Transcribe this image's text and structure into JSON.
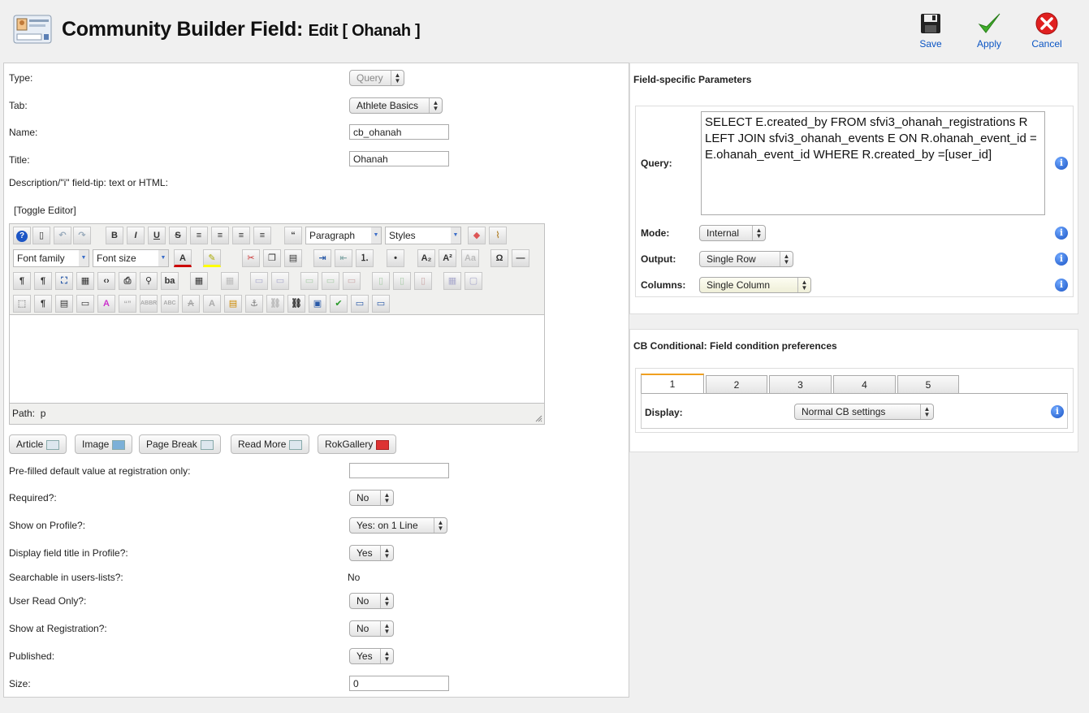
{
  "header": {
    "title": "Community Builder Field:",
    "subtitle": "Edit [ Ohanah ]",
    "save_label": "Save",
    "apply_label": "Apply",
    "cancel_label": "Cancel"
  },
  "form": {
    "type_label": "Type:",
    "type_value": "Query",
    "tab_label": "Tab:",
    "tab_value": "Athlete Basics",
    "name_label": "Name:",
    "name_value": "cb_ohanah",
    "title_label": "Title:",
    "title_value": "Ohanah",
    "description_label": "Description/\"i\" field-tip: text or HTML:",
    "toggle_editor": "[Toggle Editor]",
    "prefilled_label": "Pre-filled default value at registration only:",
    "prefilled_value": "",
    "required_label": "Required?:",
    "required_value": "No",
    "show_profile_label": "Show on Profile?:",
    "show_profile_value": "Yes: on 1 Line",
    "display_title_label": "Display field title in Profile?:",
    "display_title_value": "Yes",
    "searchable_label": "Searchable in users-lists?:",
    "searchable_value": "No",
    "read_only_label": "User Read Only?:",
    "read_only_value": "No",
    "show_reg_label": "Show at Registration?:",
    "show_reg_value": "No",
    "published_label": "Published:",
    "published_value": "Yes",
    "size_label": "Size:",
    "size_value": "0"
  },
  "editor": {
    "paragraph": "Paragraph",
    "styles": "Styles",
    "font_family": "Font family",
    "font_size": "Font size",
    "path_label": "Path:",
    "path_value": "p",
    "buttons": {
      "article": "Article",
      "image": "Image",
      "page_break": "Page Break",
      "read_more": "Read More",
      "rokgallery": "RokGallery"
    }
  },
  "field_params": {
    "title": "Field-specific Parameters",
    "query_label": "Query:",
    "query_value": "SELECT E.created_by FROM sfvi3_ohanah_registrations R LEFT JOIN sfvi3_ohanah_events E ON R.ohanah_event_id = E.ohanah_event_id WHERE R.created_by =[user_id]",
    "mode_label": "Mode:",
    "mode_value": "Internal",
    "output_label": "Output:",
    "output_value": "Single Row",
    "columns_label": "Columns:",
    "columns_value": "Single Column"
  },
  "conditional": {
    "title": "CB Conditional: Field condition preferences",
    "tabs": [
      "1",
      "2",
      "3",
      "4",
      "5"
    ],
    "display_label": "Display:",
    "display_value": "Normal CB settings"
  },
  "colors": {
    "accent_link": "#0b55c4",
    "tab_active_border": "#f0a020",
    "info_icon": "#1b55c5"
  }
}
